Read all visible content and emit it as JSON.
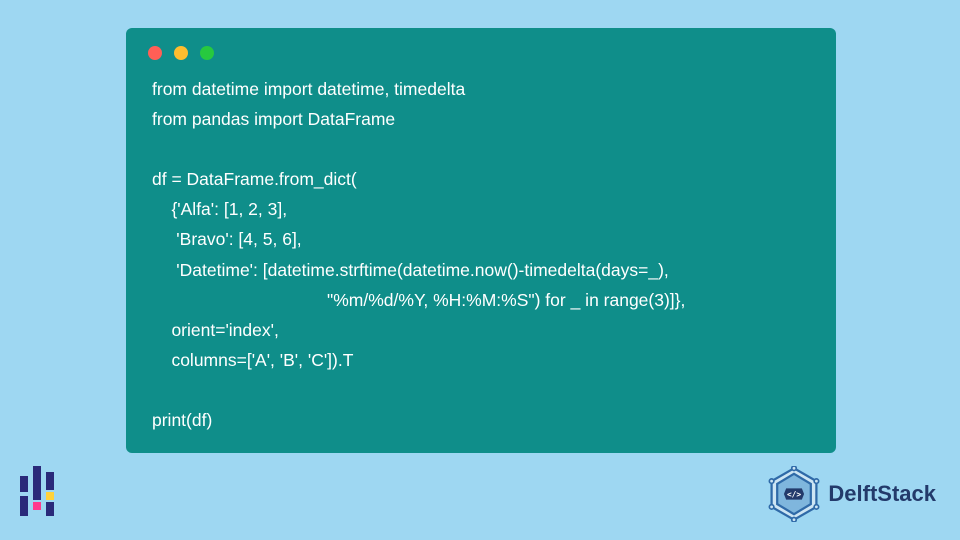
{
  "code_lines": [
    "from datetime import datetime, timedelta",
    "from pandas import DataFrame",
    "",
    "df = DataFrame.from_dict(",
    "    {'Alfa': [1, 2, 3],",
    "     'Bravo': [4, 5, 6],",
    "     'Datetime': [datetime.strftime(datetime.now()-timedelta(days=_),",
    "                                    \"%m/%d/%Y, %H:%M:%S\") for _ in range(3)]},",
    "    orient='index',",
    "    columns=['A', 'B', 'C']).T",
    "",
    "print(df)"
  ],
  "brand": {
    "name": "DelftStack"
  },
  "window_dots": {
    "red": "#ff5f56",
    "yellow": "#ffbd2e",
    "green": "#27c93f"
  }
}
